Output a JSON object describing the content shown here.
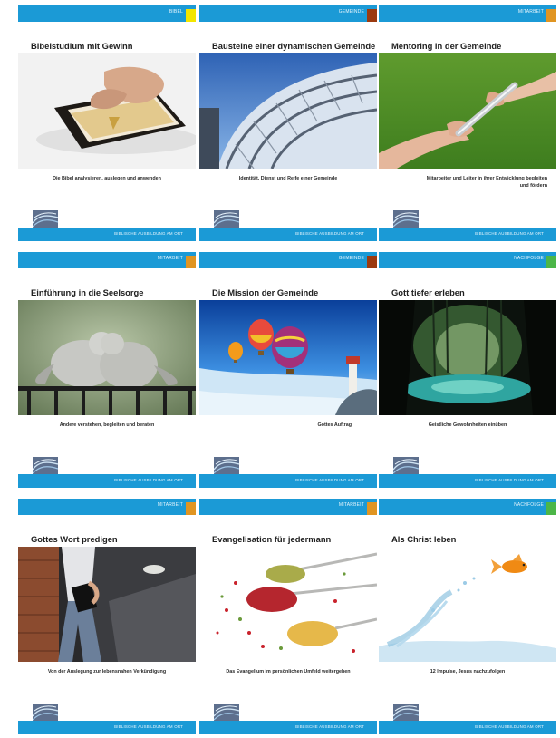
{
  "logo_text": "bao",
  "cards": [
    {
      "category": "BIBEL",
      "color": "#f3e600",
      "title": "Bibelstudium mit Gewinn",
      "subtitle": "Die Bibel analysieren, auslegen und anwenden",
      "slogan": "BIBLISCHE AUSBILDUNG AM ORT",
      "image": "bible-photo"
    },
    {
      "category": "GEMEINDE",
      "color": "#9b3a10",
      "title": "Bausteine einer dynamischen Gemeinde",
      "subtitle": "Identität, Dienst und Reife einer Gemeinde",
      "slogan": "BIBLISCHE AUSBILDUNG AM ORT",
      "image": "building-photo"
    },
    {
      "category": "MITARBEIT",
      "color": "#e09522",
      "title": "Mentoring in der Gemeinde",
      "subtitle": "Mitarbeiter und Leiter in ihrer Entwicklung begleiten und fördern",
      "slogan": "BIBLISCHE AUSBILDUNG AM ORT",
      "image": "baton-photo"
    },
    {
      "category": "MITARBEIT",
      "color": "#e09522",
      "title": "Einführung in die Seelsorge",
      "subtitle": "Andere verstehen, begleiten und beraten",
      "slogan": "BIBLISCHE AUSBILDUNG AM ORT",
      "image": "doves-photo"
    },
    {
      "category": "GEMEINDE",
      "color": "#9b3a10",
      "title": "Die Mission der Gemeinde",
      "subtitle": "Gottes Auftrag",
      "slogan": "BIBLISCHE AUSBILDUNG AM ORT",
      "image": "balloons-photo"
    },
    {
      "category": "NACHFOLGE",
      "color": "#4cb648",
      "title": "Gott tiefer erleben",
      "subtitle": "Geistliche Gewohnheiten einüben",
      "slogan": "BIBLISCHE AUSBILDUNG AM ORT",
      "image": "cave-photo"
    },
    {
      "category": "MITARBEIT",
      "color": "#e09522",
      "title": "Gottes Wort predigen",
      "subtitle": "Von der Auslegung zur lebensnahen Verkündigung",
      "slogan": "BIBLISCHE AUSBILDUNG AM ORT",
      "image": "preacher-photo"
    },
    {
      "category": "MITARBEIT",
      "color": "#e09522",
      "title": "Evangelisation für jedermann",
      "subtitle": "Das Evangelium im persönlichen Umfeld weitergeben",
      "slogan": "BIBLISCHE AUSBILDUNG AM ORT",
      "image": "spices-photo"
    },
    {
      "category": "NACHFOLGE",
      "color": "#4cb648",
      "title": "Als Christ leben",
      "subtitle": "12 Impulse, Jesus nachzufolgen",
      "slogan": "BIBLISCHE AUSBILDUNG AM ORT",
      "image": "goldfish-photo"
    }
  ]
}
